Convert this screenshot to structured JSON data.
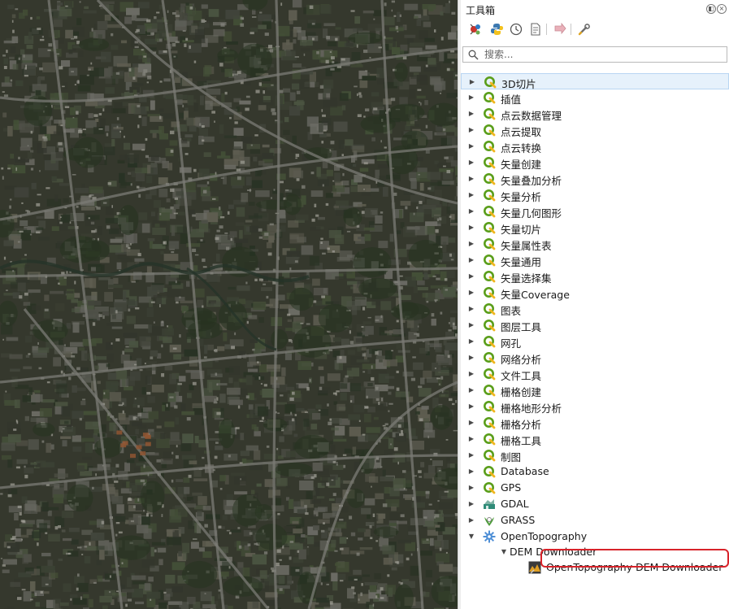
{
  "panel": {
    "title": "工具箱",
    "title_buttons": [
      "float-button",
      "close-button"
    ]
  },
  "toolbar": {
    "buttons": [
      {
        "name": "run-model-icon"
      },
      {
        "name": "python-script-icon"
      },
      {
        "name": "history-icon"
      },
      {
        "name": "results-viewer-icon"
      },
      {
        "name": "edit-features-in-place-icon"
      },
      {
        "name": "options-wrench-icon"
      }
    ]
  },
  "search": {
    "placeholder": "搜索..."
  },
  "tree": {
    "items": [
      {
        "label": "3D切片",
        "icon": "qgis-icon",
        "expanded": false,
        "selected": true
      },
      {
        "label": "插值",
        "icon": "qgis-icon"
      },
      {
        "label": "点云数据管理",
        "icon": "qgis-icon"
      },
      {
        "label": "点云提取",
        "icon": "qgis-icon"
      },
      {
        "label": "点云转换",
        "icon": "qgis-icon"
      },
      {
        "label": "矢量创建",
        "icon": "qgis-icon"
      },
      {
        "label": "矢量叠加分析",
        "icon": "qgis-icon"
      },
      {
        "label": "矢量分析",
        "icon": "qgis-icon"
      },
      {
        "label": "矢量几何图形",
        "icon": "qgis-icon"
      },
      {
        "label": "矢量切片",
        "icon": "qgis-icon"
      },
      {
        "label": "矢量属性表",
        "icon": "qgis-icon"
      },
      {
        "label": "矢量通用",
        "icon": "qgis-icon"
      },
      {
        "label": "矢量选择集",
        "icon": "qgis-icon"
      },
      {
        "label": "矢量Coverage",
        "icon": "qgis-icon"
      },
      {
        "label": "图表",
        "icon": "qgis-icon"
      },
      {
        "label": "图层工具",
        "icon": "qgis-icon"
      },
      {
        "label": "网孔",
        "icon": "qgis-icon"
      },
      {
        "label": "网络分析",
        "icon": "qgis-icon"
      },
      {
        "label": "文件工具",
        "icon": "qgis-icon"
      },
      {
        "label": "栅格创建",
        "icon": "qgis-icon"
      },
      {
        "label": "栅格地形分析",
        "icon": "qgis-icon"
      },
      {
        "label": "栅格分析",
        "icon": "qgis-icon"
      },
      {
        "label": "栅格工具",
        "icon": "qgis-icon"
      },
      {
        "label": "制图",
        "icon": "qgis-icon"
      },
      {
        "label": "Database",
        "icon": "qgis-icon"
      },
      {
        "label": "GPS",
        "icon": "qgis-icon"
      },
      {
        "label": "GDAL",
        "icon": "gdal-icon"
      },
      {
        "label": "GRASS",
        "icon": "grass-icon"
      },
      {
        "label": "OpenTopography",
        "icon": "opentopography-gear-icon",
        "expanded": true
      },
      {
        "label": "DEM Downloader",
        "level": 1,
        "expanded": true
      },
      {
        "label": "OpenTopography DEM Downloader",
        "level": 2,
        "icon": "dem-tool-icon",
        "highlighted": true
      }
    ]
  },
  "colors": {
    "qgis_green": "#5a9e1a",
    "highlight_red": "#d8232a",
    "selection_blue": "#e6f1fb"
  }
}
